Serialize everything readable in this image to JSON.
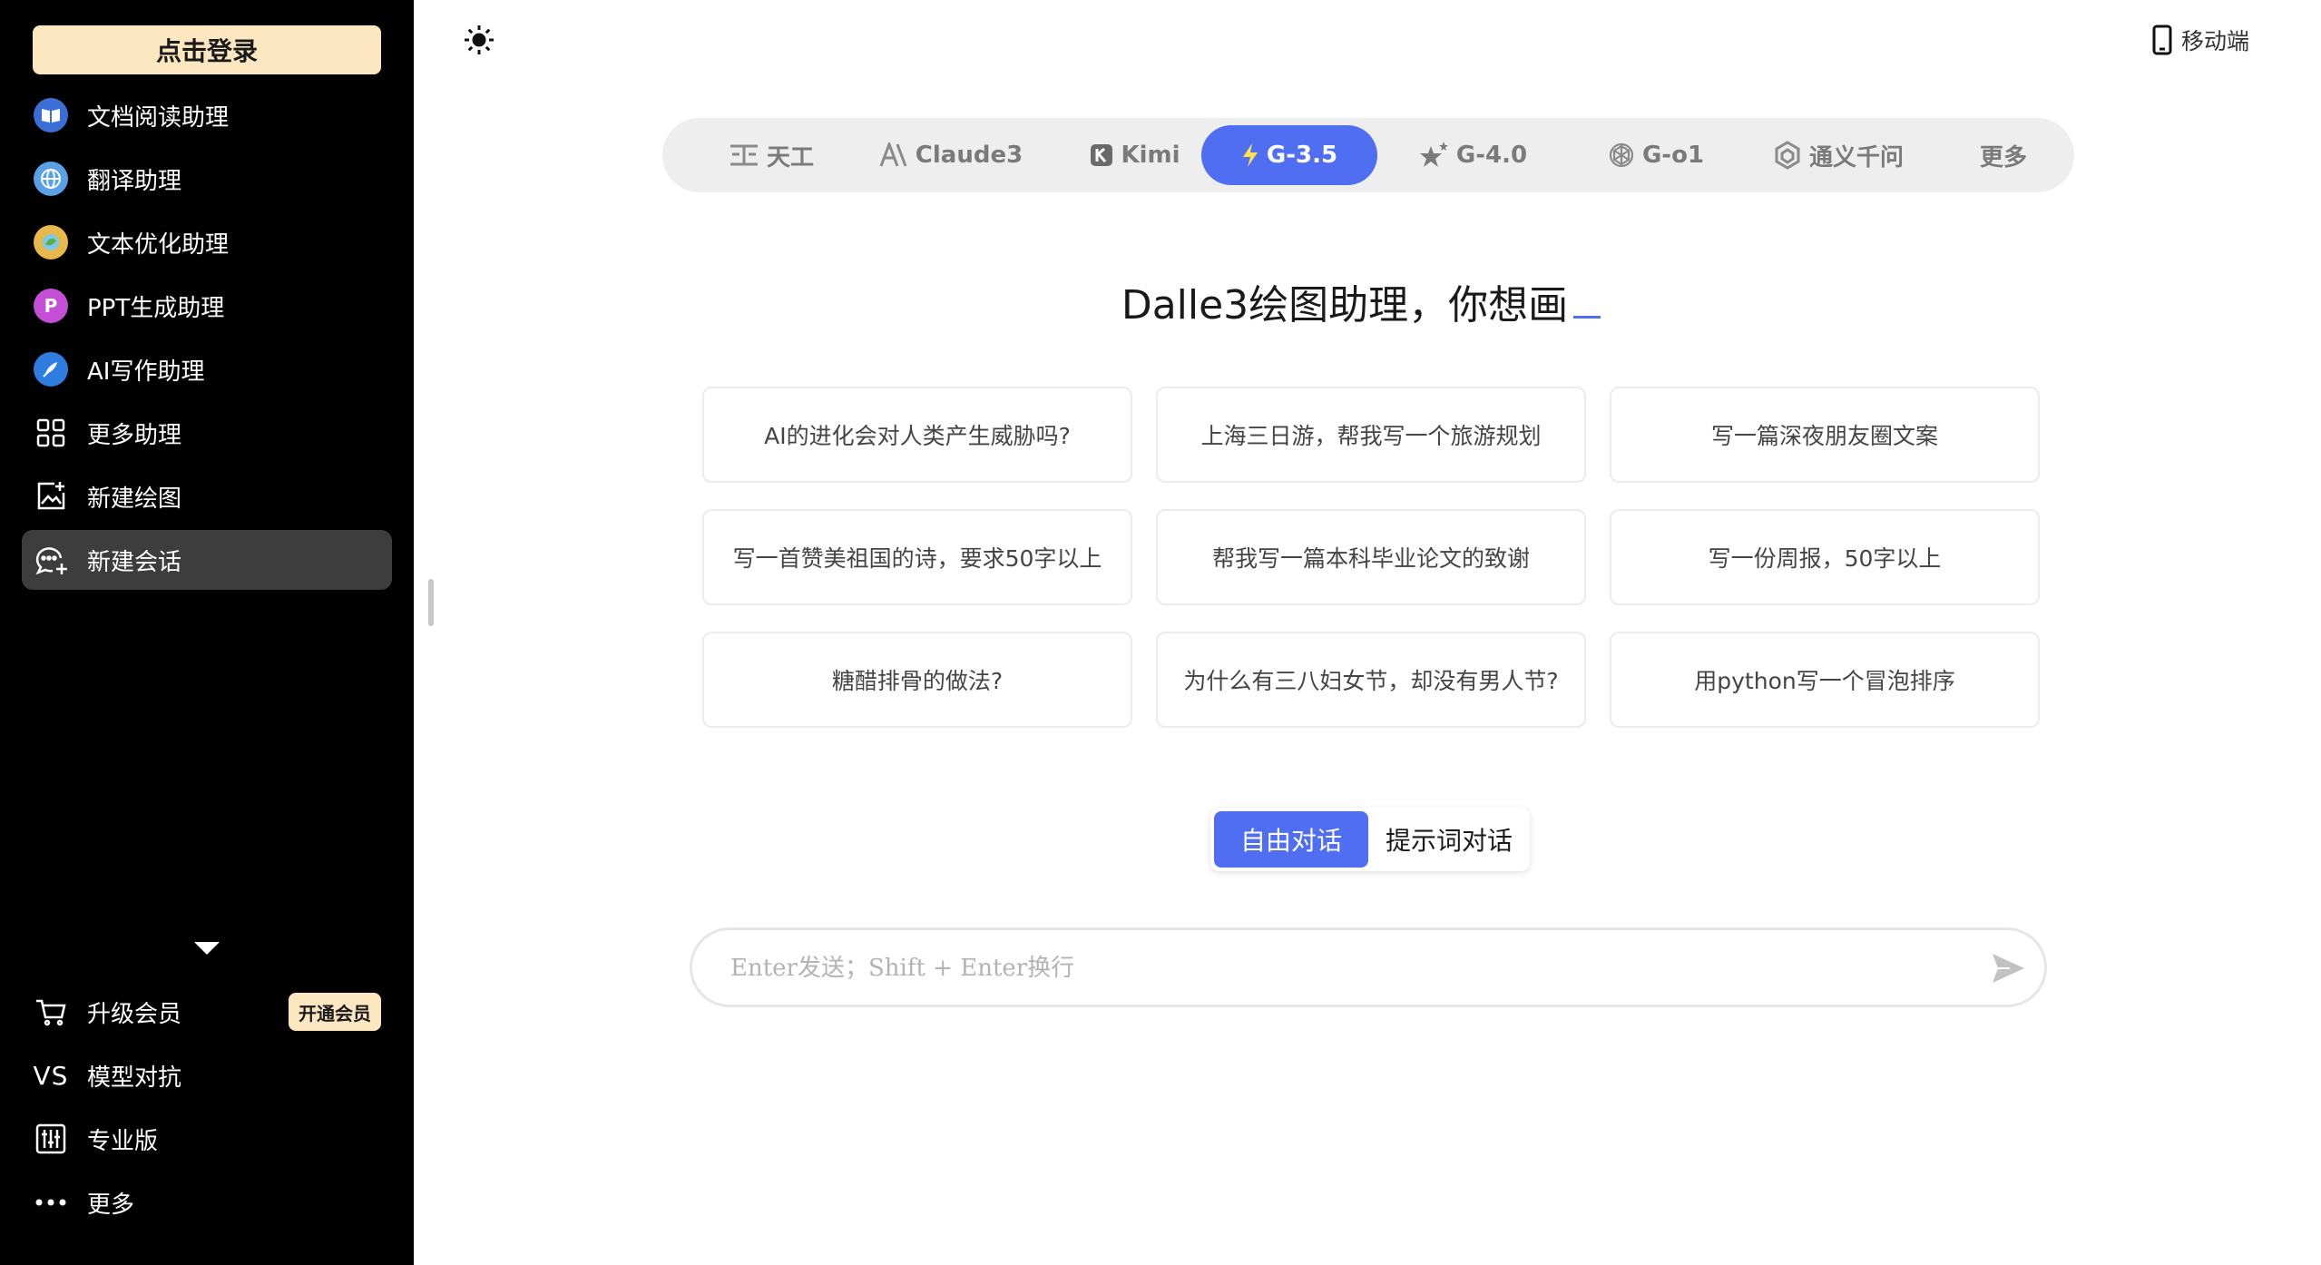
{
  "sidebar": {
    "login_label": "点击登录",
    "items": [
      {
        "label": "文档阅读助理",
        "icon": "book-icon",
        "color": "#3b6fd8"
      },
      {
        "label": "翻译助理",
        "icon": "globe-icon",
        "color": "#5aa0e6"
      },
      {
        "label": "文本优化助理",
        "icon": "leaf-icon",
        "color": "#e9b84a"
      },
      {
        "label": "PPT生成助理",
        "icon": "ppt-icon",
        "color": "#c44fd6",
        "glyph": "P"
      },
      {
        "label": "AI写作助理",
        "icon": "quill-icon",
        "color": "#2f7de0"
      },
      {
        "label": "更多助理",
        "icon": "grid-icon"
      },
      {
        "label": "新建绘图",
        "icon": "image-plus-icon"
      },
      {
        "label": "新建会话",
        "icon": "chat-plus-icon",
        "active": true
      }
    ],
    "bottom": [
      {
        "label": "升级会员",
        "icon": "cart-icon"
      },
      {
        "label": "模型对抗",
        "icon": "vs-icon",
        "glyph": "VS"
      },
      {
        "label": "专业版",
        "icon": "sliders-icon"
      },
      {
        "label": "更多",
        "icon": "ellipsis-icon"
      }
    ],
    "vip_badge": "开通会员"
  },
  "topbar": {
    "mobile_label": "移动端"
  },
  "models": [
    {
      "label": "天工",
      "icon": "tiangong-icon"
    },
    {
      "label": "Claude3",
      "icon": "anthropic-icon"
    },
    {
      "label": "Kimi",
      "icon": "kimi-icon"
    },
    {
      "label": "G-3.5",
      "icon": "bolt-icon",
      "active": true
    },
    {
      "label": "G-4.0",
      "icon": "star-icon"
    },
    {
      "label": "G-o1",
      "icon": "openai-icon"
    },
    {
      "label": "通义千问",
      "icon": "tongyi-icon"
    },
    {
      "label": "更多"
    }
  ],
  "headline": "Dalle3绘图助理，你想画",
  "suggestions": [
    "AI的进化会对人类产生威胁吗?",
    "上海三日游，帮我写一个旅游规划",
    "写一篇深夜朋友圈文案",
    "写一首赞美祖国的诗，要求50字以上",
    "帮我写一篇本科毕业论文的致谢",
    "写一份周报，50字以上",
    "糖醋排骨的做法?",
    "为什么有三八妇女节，却没有男人节?",
    "用python写一个冒泡排序"
  ],
  "modes": [
    {
      "label": "自由对话",
      "active": true
    },
    {
      "label": "提示词对话"
    }
  ],
  "input": {
    "placeholder": "Enter发送；Shift + Enter换行",
    "value": ""
  },
  "colors": {
    "accent": "#4f6ef2",
    "login_bg": "#fde7c0",
    "sidebar_bg": "#000000"
  }
}
